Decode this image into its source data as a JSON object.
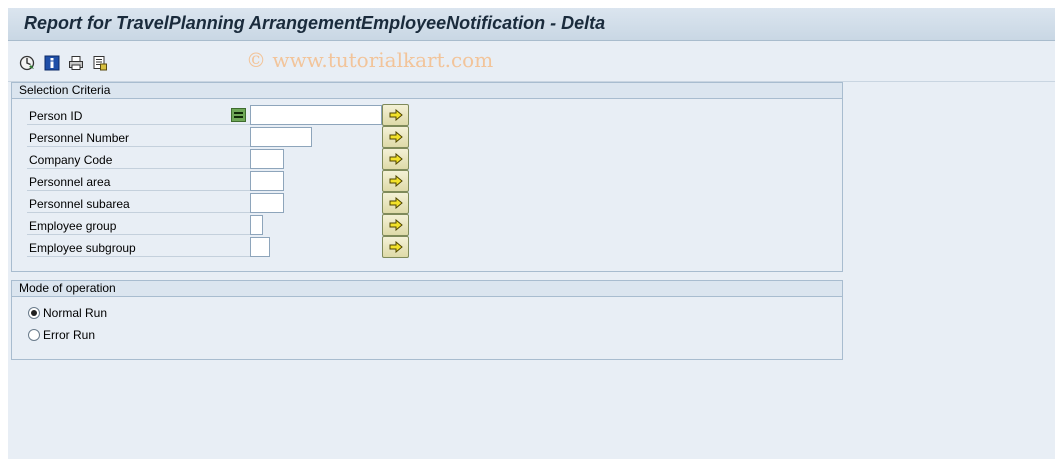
{
  "title": "Report for TravelPlanning ArrangementEmployeeNotification - Delta",
  "watermark": "© www.tutorialkart.com",
  "toolbar": {
    "icons": [
      "execute-icon",
      "info-icon",
      "print-icon",
      "variant-icon"
    ]
  },
  "selection_criteria": {
    "header": "Selection Criteria",
    "rows": [
      {
        "label": "Person ID",
        "value": ""
      },
      {
        "label": "Personnel Number",
        "value": ""
      },
      {
        "label": "Company Code",
        "value": ""
      },
      {
        "label": "Personnel area",
        "value": ""
      },
      {
        "label": "Personnel subarea",
        "value": ""
      },
      {
        "label": "Employee group",
        "value": ""
      },
      {
        "label": "Employee subgroup",
        "value": ""
      }
    ]
  },
  "mode_of_operation": {
    "header": "Mode of operation",
    "options": [
      {
        "label": "Normal Run",
        "selected": true
      },
      {
        "label": "Error Run",
        "selected": false
      }
    ]
  },
  "colors": {
    "background": "#e8eef5",
    "title_bar": "#c9d7e4",
    "multi_button": "#dedaa8"
  }
}
